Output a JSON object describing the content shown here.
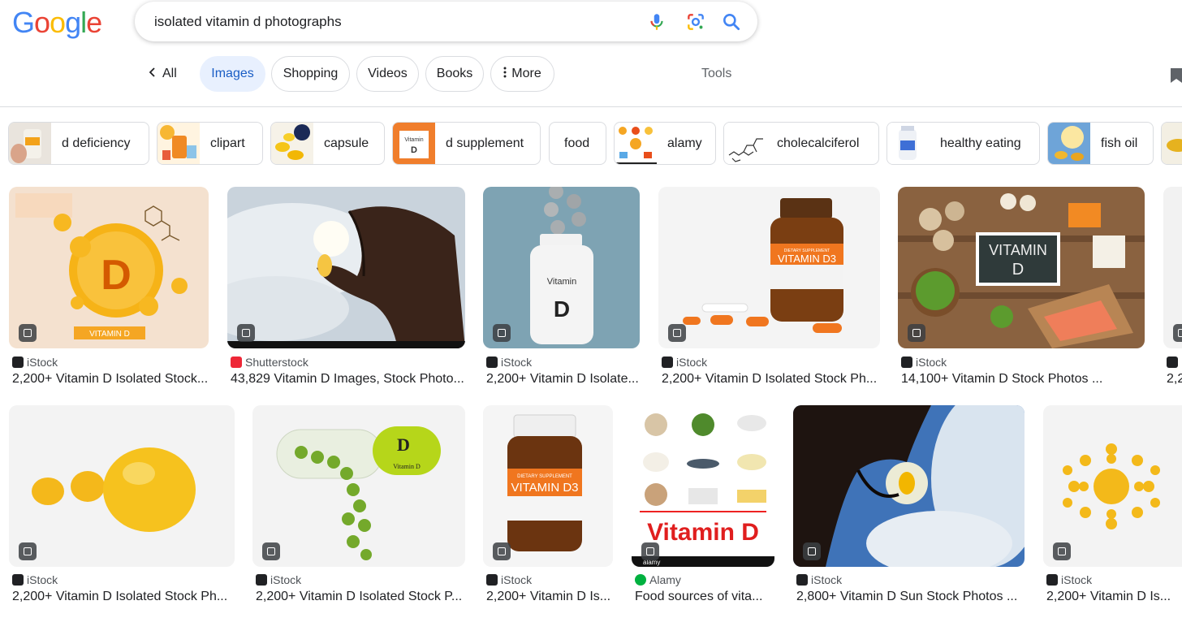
{
  "logo": {
    "letters": [
      "G",
      "o",
      "o",
      "g",
      "l",
      "e"
    ],
    "colors": [
      "#4285f4",
      "#ea4335",
      "#fbbc05",
      "#4285f4",
      "#34a853",
      "#ea4335"
    ]
  },
  "search": {
    "query": "isolated vitamin d photographs",
    "icons": [
      "mic-icon",
      "lens-icon",
      "search-icon"
    ]
  },
  "tabs": {
    "all": "All",
    "items": [
      "Images",
      "Shopping",
      "Videos",
      "Books"
    ],
    "more": "More",
    "tools": "Tools"
  },
  "chips": [
    {
      "label": "d deficiency"
    },
    {
      "label": "clipart"
    },
    {
      "label": "capsule"
    },
    {
      "label": "d supplement"
    },
    {
      "label": "food"
    },
    {
      "label": "alamy"
    },
    {
      "label": "cholecalciferol"
    },
    {
      "label": "healthy eating"
    },
    {
      "label": "fish oil"
    }
  ],
  "results": [
    {
      "source": "iStock",
      "title": "2,200+ Vitamin D Isolated Stock..."
    },
    {
      "source": "Shutterstock",
      "title": "43,829 Vitamin D Images, Stock Photo..."
    },
    {
      "source": "iStock",
      "title": "2,200+ Vitamin D Isolate..."
    },
    {
      "source": "iStock",
      "title": "2,200+ Vitamin D Isolated Stock Ph..."
    },
    {
      "source": "iStock",
      "title": "14,100+ Vitamin D Stock Photos ..."
    },
    {
      "source": "iStock",
      "title": "2,2"
    },
    {
      "source": "iStock",
      "title": "2,200+ Vitamin D Isolated Stock Ph..."
    },
    {
      "source": "iStock",
      "title": "2,200+ Vitamin D Isolated Stock P..."
    },
    {
      "source": "iStock",
      "title": "2,200+ Vitamin D Is..."
    },
    {
      "source": "Alamy",
      "title": "Food sources of vita..."
    },
    {
      "source": "iStock",
      "title": "2,800+ Vitamin D Sun Stock Photos ..."
    },
    {
      "source": "iStock",
      "title": "2,200+ Vitamin D Is..."
    }
  ],
  "image_text": {
    "r1c1_letter": "D",
    "r1c1_label": "VITAMIN D",
    "r1c3_line1": "Vitamin",
    "r1c3_line2": "D",
    "r1c4_small": "DIETARY SUPPLEMENT",
    "r1c4_big": "VITAMIN D3",
    "r1c5_line1": "VITAMIN",
    "r1c5_line2": "D",
    "r2c2_letter": "D",
    "r2c2_label": "Vitamin D",
    "r2c3_small": "DIETARY SUPPLEMENT",
    "r2c3_big": "VITAMIN D3",
    "r2c4_big": "Vitamin D",
    "r2c4_footer": "alamy",
    "chip4_l1": "Vitamin",
    "chip4_l2": "D"
  },
  "source_colors": {
    "iStock": "#202124",
    "Shutterstock": "#ee2737",
    "Alamy": "#00b140"
  }
}
